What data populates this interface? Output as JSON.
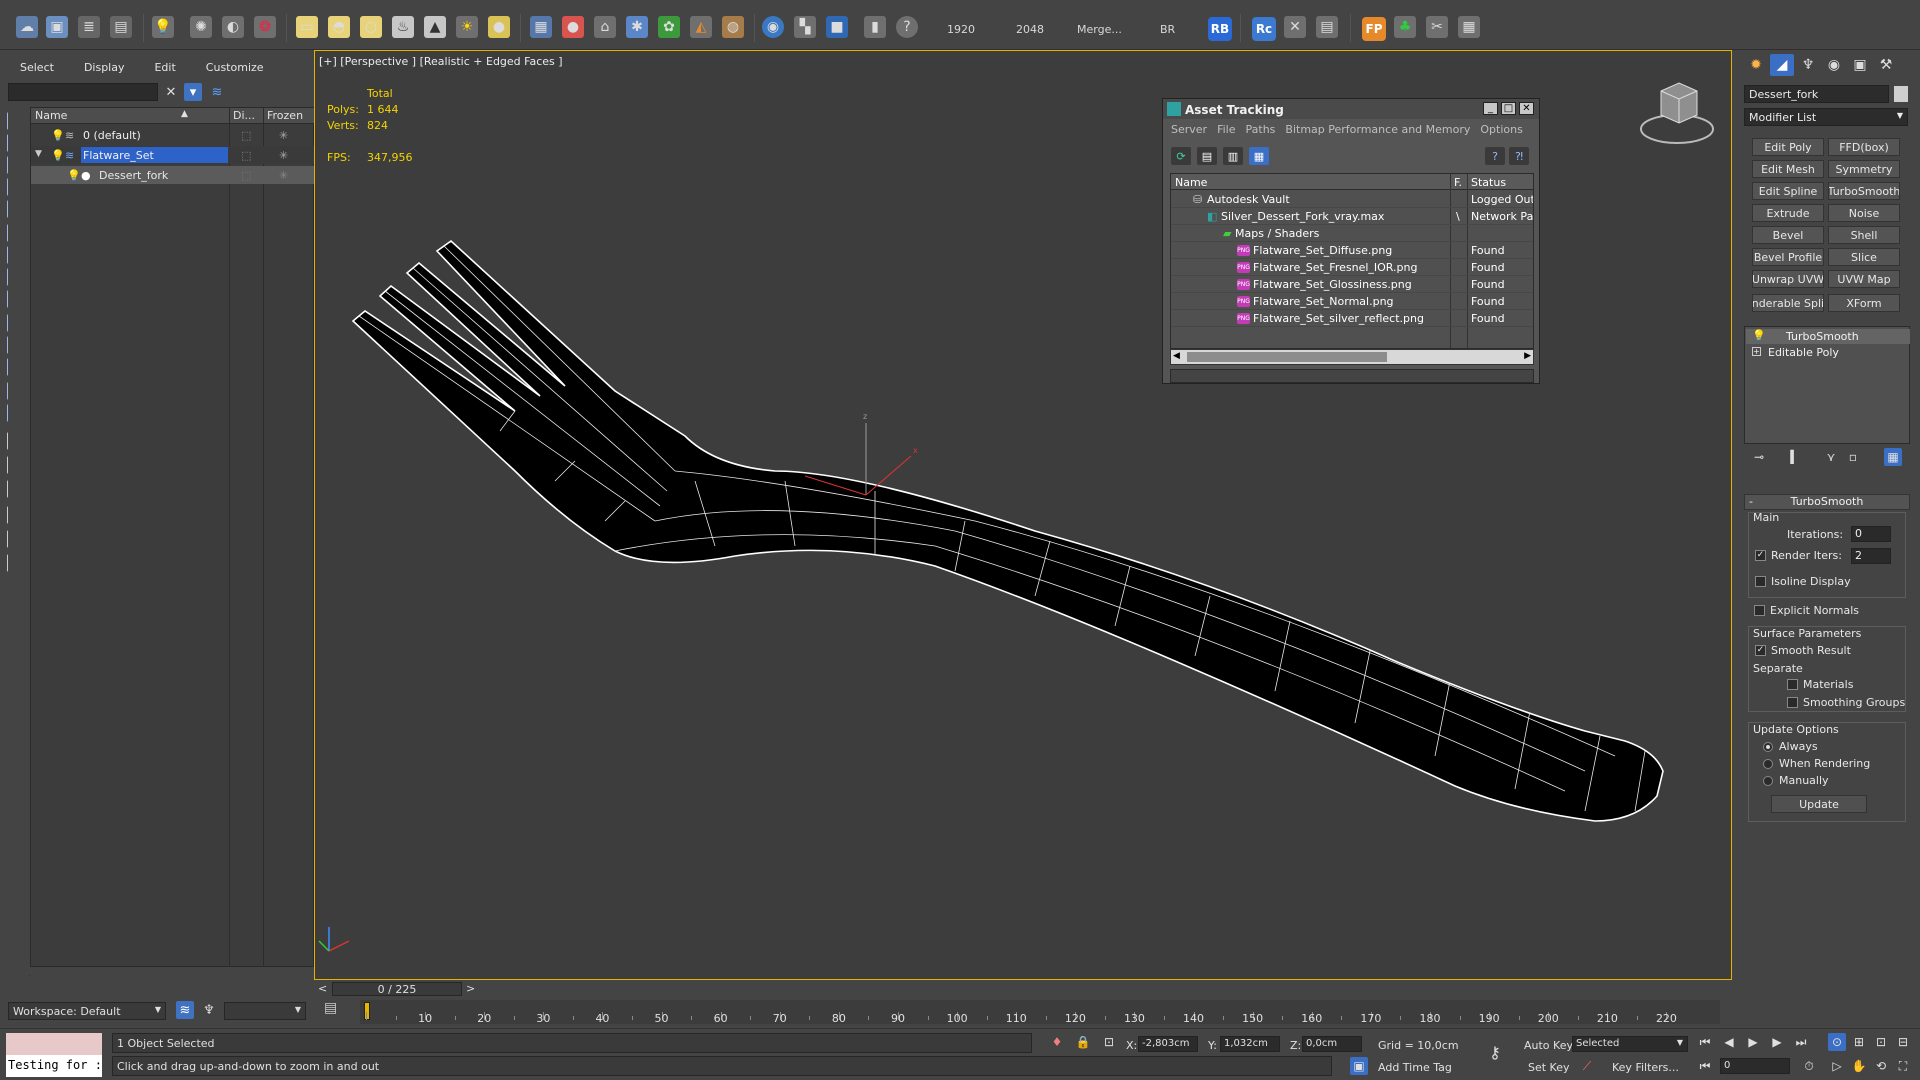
{
  "toolbar": {
    "render_width": "1920",
    "render_height": "2048",
    "merge_label": "Merge...",
    "br_label": "BR",
    "badges": [
      "RB",
      "Rc",
      "FP"
    ]
  },
  "explorer": {
    "menus": [
      "Select",
      "Display",
      "Edit",
      "Customize"
    ],
    "columns": {
      "name": "Name",
      "display": "Di...",
      "frozen": "Frozen"
    },
    "rows": [
      {
        "label": "0 (default)"
      },
      {
        "label": "Flatware_Set"
      },
      {
        "label": "Dessert_fork"
      }
    ]
  },
  "workspace": {
    "label": "Workspace: Default"
  },
  "viewport": {
    "label": "[+] [Perspective ] [Realistic + Edged Faces ]",
    "stats": {
      "total_label": "Total",
      "polys_label": "Polys:",
      "polys_value": "1 644",
      "verts_label": "Verts:",
      "verts_value": "824",
      "fps_label": "FPS:",
      "fps_value": "347,956"
    },
    "gizmo_labels": {
      "z": "z",
      "x": "x"
    }
  },
  "asset_tracking": {
    "title": "Asset Tracking",
    "menus": [
      "Server",
      "File",
      "Paths",
      "Bitmap Performance and Memory",
      "Options"
    ],
    "columns": {
      "name": "Name",
      "f": "F.",
      "status": "Status"
    },
    "rows": [
      {
        "name": "Autodesk Vault",
        "f": "",
        "status": "Logged Out"
      },
      {
        "name": "Silver_Dessert_Fork_vray.max",
        "f": "\\",
        "status": "Network Pat"
      },
      {
        "name": "Maps / Shaders",
        "f": "",
        "status": ""
      },
      {
        "name": "Flatware_Set_Diffuse.png",
        "f": "",
        "status": "Found"
      },
      {
        "name": "Flatware_Set_Fresnel_IOR.png",
        "f": "",
        "status": "Found"
      },
      {
        "name": "Flatware_Set_Glossiness.png",
        "f": "",
        "status": "Found"
      },
      {
        "name": "Flatware_Set_Normal.png",
        "f": "",
        "status": "Found"
      },
      {
        "name": "Flatware_Set_silver_reflect.png",
        "f": "",
        "status": "Found"
      }
    ],
    "png_tag": "PNG"
  },
  "command_panel": {
    "object_name": "Dessert_fork",
    "modifier_list": "Modifier List",
    "modifier_buttons": [
      "Edit Poly",
      "FFD(box)",
      "Edit Mesh",
      "Symmetry",
      "Edit Spline",
      "TurboSmooth",
      "Extrude",
      "Noise",
      "Bevel",
      "Shell",
      "Bevel Profile",
      "Slice",
      "Unwrap UVW",
      "UVW Map",
      "enderable Splin",
      "XForm"
    ],
    "stack": [
      "TurboSmooth",
      "Editable Poly"
    ],
    "turbosmooth": {
      "title": "TurboSmooth",
      "main": "Main",
      "iterations_label": "Iterations:",
      "iterations_value": "0",
      "render_iters_label": "Render Iters:",
      "render_iters_value": "2",
      "isoline": "Isoline Display",
      "explicit": "Explicit Normals",
      "surface_params": "Surface Parameters",
      "smooth_result": "Smooth Result",
      "separate": "Separate",
      "materials": "Materials",
      "smoothing_groups": "Smoothing Groups",
      "update_options": "Update Options",
      "always": "Always",
      "when_rendering": "When Rendering",
      "manually": "Manually",
      "update_btn": "Update"
    }
  },
  "timeline": {
    "frame_counter": "0 / 225",
    "prev": "<",
    "next": ">",
    "ticks": [
      "10",
      "20",
      "30",
      "40",
      "50",
      "60",
      "70",
      "80",
      "90",
      "100",
      "110",
      "120",
      "130",
      "140",
      "150",
      "160",
      "170",
      "180",
      "190",
      "200",
      "210",
      "220"
    ]
  },
  "status": {
    "maxscript_text": "Testing for :",
    "selection": "1 Object Selected",
    "prompt": "Click and drag up-and-down to zoom in and out",
    "x_label": "X:",
    "x_value": "-2,803cm",
    "y_label": "Y:",
    "y_value": "1,032cm",
    "z_label": "Z:",
    "z_value": "0,0cm",
    "grid": "Grid = 10,0cm",
    "add_time_tag": "Add Time Tag",
    "auto_key": "Auto Key",
    "set_key": "Set Key",
    "selected": "Selected",
    "key_filters": "Key Filters...",
    "frame_value": "0"
  }
}
